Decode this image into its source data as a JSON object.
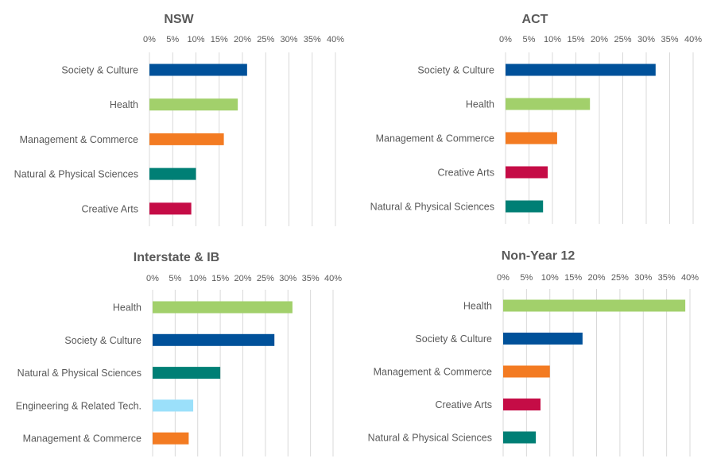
{
  "colors": {
    "Society & Culture": "#00519a",
    "Health": "#a2d06b",
    "Management & Commerce": "#f37b22",
    "Natural & Physical Sciences": "#007f75",
    "Creative Arts": "#c50c46",
    "Engineering & Related Tech.": "#9be0fa"
  },
  "chart_data": [
    {
      "type": "bar",
      "orientation": "horizontal",
      "title": "NSW",
      "categories": [
        "Society & Culture",
        "Health",
        "Management & Commerce",
        "Natural & Physical Sciences",
        "Creative Arts"
      ],
      "values": [
        21,
        19,
        16,
        10,
        9
      ],
      "xlim": [
        0,
        40
      ],
      "xticks": [
        "0%",
        "5%",
        "10%",
        "15%",
        "20%",
        "25%",
        "30%",
        "35%",
        "40%"
      ],
      "unit": "%",
      "grid": true,
      "axis_position": "top"
    },
    {
      "type": "bar",
      "orientation": "horizontal",
      "title": "ACT",
      "categories": [
        "Society & Culture",
        "Health",
        "Management & Commerce",
        "Creative Arts",
        "Natural & Physical Sciences"
      ],
      "values": [
        32,
        18,
        11,
        9,
        8
      ],
      "xlim": [
        0,
        40
      ],
      "xticks": [
        "0%",
        "5%",
        "10%",
        "15%",
        "20%",
        "25%",
        "30%",
        "35%",
        "40%"
      ],
      "unit": "%",
      "grid": true,
      "axis_position": "top"
    },
    {
      "type": "bar",
      "orientation": "horizontal",
      "title": "Interstate & IB",
      "categories": [
        "Health",
        "Society & Culture",
        "Natural & Physical Sciences",
        "Engineering & Related Tech.",
        "Management & Commerce"
      ],
      "values": [
        31,
        27,
        15,
        9,
        8
      ],
      "xlim": [
        0,
        40
      ],
      "xticks": [
        "0%",
        "5%",
        "10%",
        "15%",
        "20%",
        "25%",
        "30%",
        "35%",
        "40%"
      ],
      "unit": "%",
      "grid": true,
      "axis_position": "top"
    },
    {
      "type": "bar",
      "orientation": "horizontal",
      "title": "Non-Year 12",
      "categories": [
        "Health",
        "Society & Culture",
        "Management & Commerce",
        "Creative Arts",
        "Natural & Physical Sciences"
      ],
      "values": [
        39,
        17,
        10,
        8,
        7
      ],
      "xlim": [
        0,
        40
      ],
      "xticks": [
        "0%",
        "5%",
        "10%",
        "15%",
        "20%",
        "25%",
        "30%",
        "35%",
        "40%"
      ],
      "unit": "%",
      "grid": true,
      "axis_position": "top"
    }
  ]
}
